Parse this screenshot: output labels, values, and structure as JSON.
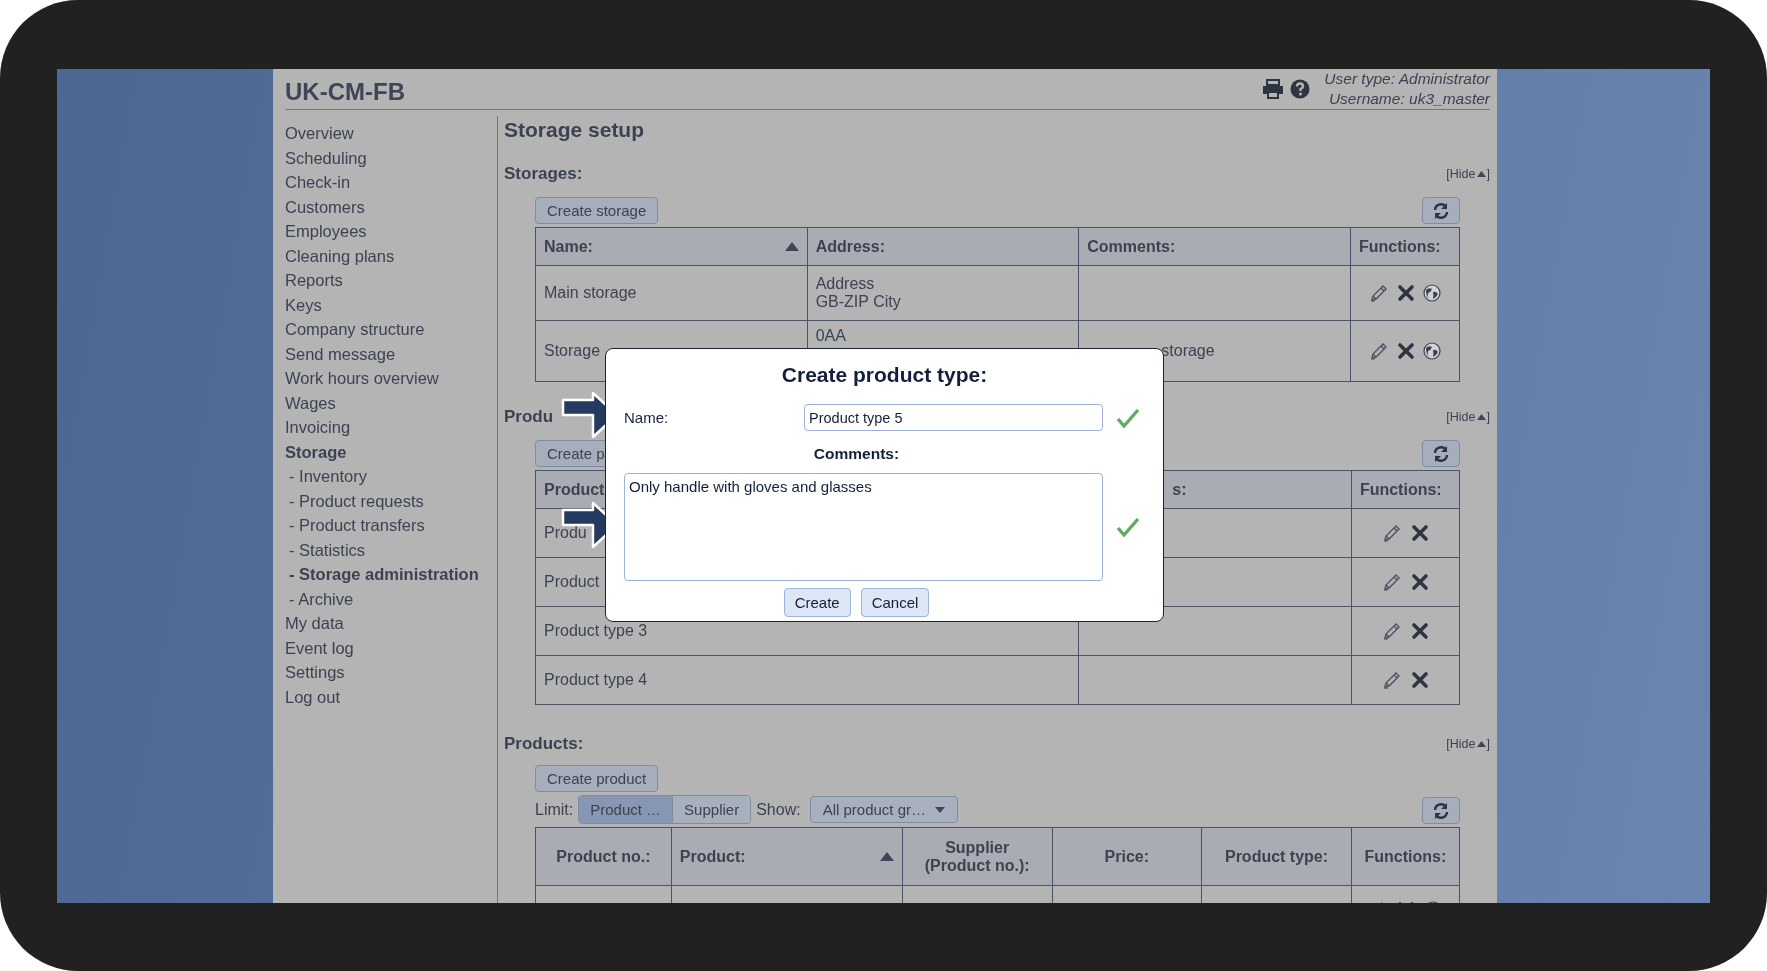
{
  "app": {
    "title": "UK-CM-FB",
    "user_type": "User type: Administrator",
    "username": "Username: uk3_master"
  },
  "sidebar": {
    "items": [
      {
        "label": "Overview",
        "selected": false
      },
      {
        "label": "Scheduling",
        "selected": false
      },
      {
        "label": "Check-in",
        "selected": false
      },
      {
        "label": "Customers",
        "selected": false
      },
      {
        "label": "Employees",
        "selected": false
      },
      {
        "label": "Cleaning plans",
        "selected": false
      },
      {
        "label": "Reports",
        "selected": false
      },
      {
        "label": "Keys",
        "selected": false
      },
      {
        "label": "Company structure",
        "selected": false
      },
      {
        "label": "Send message",
        "selected": false
      },
      {
        "label": "Work hours overview",
        "selected": false
      },
      {
        "label": "Wages",
        "selected": false
      },
      {
        "label": "Invoicing",
        "selected": false
      },
      {
        "label": "Storage",
        "selected": true,
        "children": [
          {
            "label": "- Inventory",
            "selected": false
          },
          {
            "label": "- Product requests",
            "selected": false
          },
          {
            "label": "- Product transfers",
            "selected": false
          },
          {
            "label": "- Statistics",
            "selected": false
          },
          {
            "label": "- Storage administration",
            "selected": true
          },
          {
            "label": "- Archive",
            "selected": false
          }
        ]
      },
      {
        "label": "My data",
        "selected": false
      },
      {
        "label": "Event log",
        "selected": false
      },
      {
        "label": "Settings",
        "selected": false
      },
      {
        "label": "Log out",
        "selected": false
      }
    ]
  },
  "page_title": "Storage setup",
  "sections": [
    {
      "kind": "storages",
      "title": "Storages:",
      "hide_open": "[Hide",
      "hide_close": "]",
      "create_button": "Create storage",
      "table": {
        "columns": [
          {
            "label": "Name:",
            "sorted": true,
            "kind": "plain"
          },
          {
            "label": "Address:",
            "sorted": false,
            "kind": "plain"
          },
          {
            "label": "Comments:",
            "sorted": false,
            "kind": "plain"
          },
          {
            "label": "Functions:",
            "sorted": false,
            "kind": "plain"
          }
        ],
        "rows": [
          {
            "cells": [
              {
                "text": "Main storage",
                "kind": "plain"
              },
              {
                "text": "Address\nGB-ZIP City",
                "kind": "plain"
              }
            ],
            "web_link": true
          },
          {
            "cells": [
              {
                "text": "Storage",
                "kind": "plain"
              },
              {
                "text": "0AA",
                "kind": "head"
              },
              {
                "text": "storage",
                "kind": "tail"
              }
            ],
            "web_link": true
          }
        ]
      }
    },
    {
      "kind": "product_types",
      "title": "Produ",
      "hide_open": "[Hide",
      "hide_close": "]",
      "create_button": "Create p",
      "table": {
        "columns": [
          {
            "label": "Product",
            "kind": "plain"
          },
          {
            "label": "s:",
            "kind": "tail"
          },
          {
            "label": "Functions:",
            "kind": "plain"
          }
        ],
        "rows": [
          {
            "cells": [
              {
                "text": "Produ",
                "kind": "plain"
              }
            ],
            "web_link": false
          },
          {
            "cells": [
              {
                "text": "Product",
                "kind": "plain"
              }
            ],
            "web_link": false
          },
          {
            "cells": [
              {
                "text": "Product type 3",
                "kind": "plain"
              }
            ],
            "web_link": false
          },
          {
            "cells": [
              {
                "text": "Product type 4",
                "kind": "plain"
              }
            ],
            "web_link": false
          }
        ]
      }
    },
    {
      "kind": "products",
      "title": "Products:",
      "hide_open": "[Hide",
      "hide_close": "]",
      "create_button": "Create product",
      "filters": {
        "limit_label": "Limit:",
        "limit_options": [
          {
            "label": "Product …",
            "selected": true
          },
          {
            "label": "Supplier",
            "selected": false
          }
        ],
        "show_label": "Show:",
        "show_value": "All product gr…"
      },
      "table": {
        "columns": [
          {
            "label": "Product no.:",
            "sorted": false,
            "kind": "plain"
          },
          {
            "label": "Product:",
            "sorted": true,
            "kind": "plain"
          },
          {
            "label": "Supplier\n(Product no.):",
            "sorted": false,
            "kind": "plain"
          },
          {
            "label": "Price:",
            "sorted": false,
            "kind": "plain"
          },
          {
            "label": "Product type:",
            "sorted": false,
            "kind": "plain"
          },
          {
            "label": "Functions:",
            "sorted": false,
            "kind": "plain"
          }
        ],
        "rows": [
          {
            "cells": [],
            "web_link": true
          }
        ]
      }
    }
  ],
  "dialog": {
    "title": "Create product type:",
    "name_label": "Name:",
    "name_value": "Product type 5",
    "name_valid": true,
    "comments_label": "Comments:",
    "comments_value": "Only handle with gloves and glasses",
    "comments_valid": true,
    "buttons": [
      "Create",
      "Cancel"
    ]
  }
}
